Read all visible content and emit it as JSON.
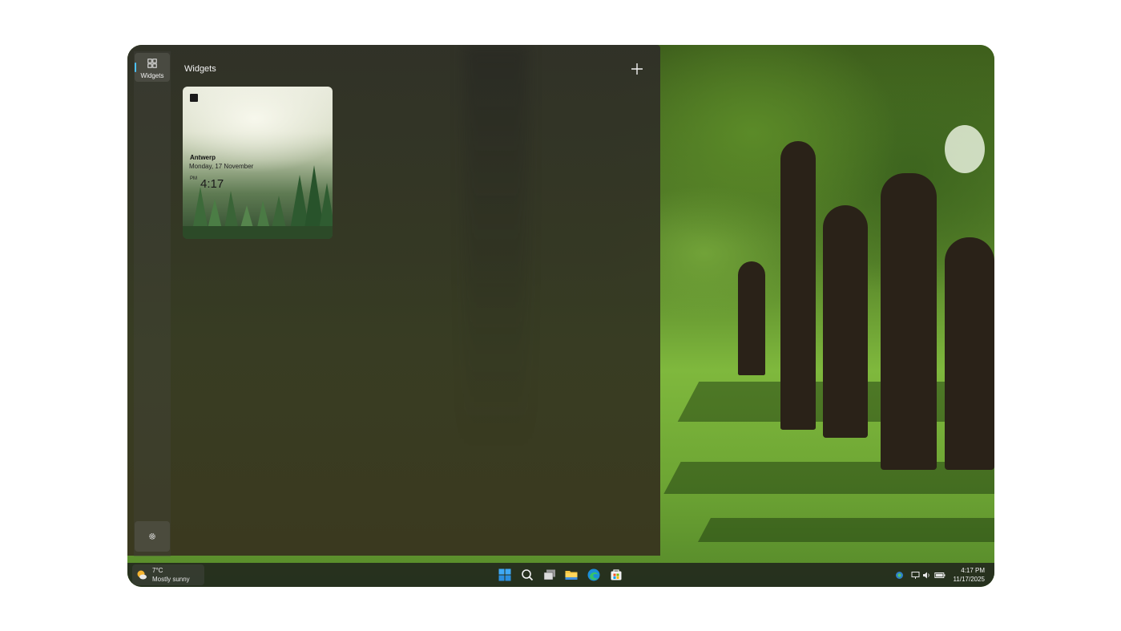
{
  "panel": {
    "title": "Widgets",
    "rail_items": [
      {
        "label": "Widgets",
        "icon": "widgets-icon",
        "active": true
      }
    ],
    "settings_icon": "gear-icon",
    "add_icon": "plus-icon"
  },
  "clock_widget": {
    "city": "Antwerp",
    "date": "Monday, 17 November",
    "ampm": "PM",
    "time": "4:17"
  },
  "taskbar": {
    "weather": {
      "temperature": "7°C",
      "condition": "Mostly sunny",
      "icon": "partly-sunny-icon"
    },
    "apps": [
      {
        "name": "start",
        "icon": "windows-start-icon"
      },
      {
        "name": "search",
        "icon": "search-icon"
      },
      {
        "name": "task-view",
        "icon": "task-view-icon"
      },
      {
        "name": "file-explorer",
        "icon": "folder-icon"
      },
      {
        "name": "edge",
        "icon": "edge-browser-icon"
      },
      {
        "name": "store",
        "icon": "store-icon"
      }
    ],
    "tray": [
      "shield-icon",
      "network-icon",
      "volume-icon",
      "battery-icon"
    ],
    "time": "4:17 PM",
    "date": "11/17/2025"
  },
  "colors": {
    "accent": "#4cc2ff",
    "panel_bg": "#33342a",
    "taskbar_bg": "#20241c"
  }
}
